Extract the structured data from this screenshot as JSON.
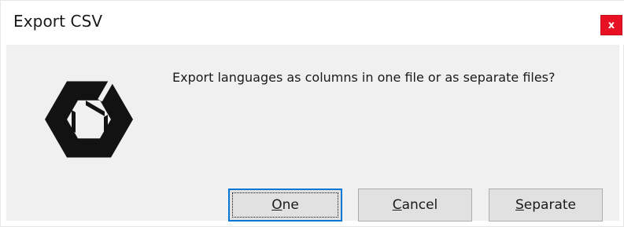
{
  "window": {
    "title": "Export CSV",
    "close_glyph": "x"
  },
  "icons": {
    "app_logo": "unity-logo-icon",
    "close": "close-icon"
  },
  "dialog": {
    "message": "Export languages as columns in one file or as separate files?"
  },
  "buttons": {
    "one": "One",
    "cancel": "Cancel",
    "separate": "Separate",
    "default_focused": "One"
  },
  "colors": {
    "close_button": "#e81123",
    "focus_border": "#0078d7",
    "dialog_background": "#f0f0f0",
    "button_background": "#e1e1e1"
  }
}
